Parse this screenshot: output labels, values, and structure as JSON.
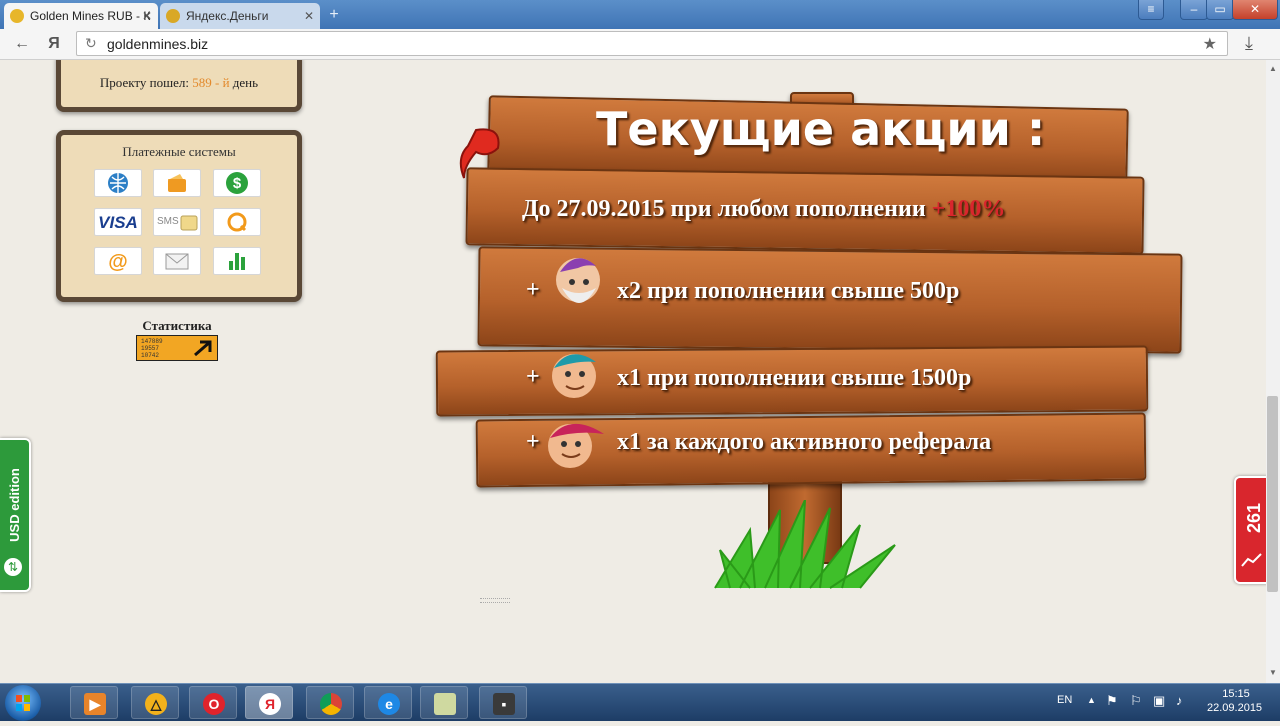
{
  "browser": {
    "tabs": [
      {
        "title": "Golden Mines RUB - К",
        "active": true
      },
      {
        "title": "Яндекс.Деньги",
        "active": false
      }
    ],
    "url": "goldenmines.biz",
    "yandex_glyph": "Я"
  },
  "sidebar": {
    "project_prefix": "Проекту пошел:",
    "project_day": "589 - й",
    "project_suffix": "день",
    "payment_title": "Платежные системы",
    "payment_icons": [
      "webmoney-icon",
      "wallet-icon",
      "dollar-icon",
      "visa-icon",
      "sms-icon",
      "qiwi-icon",
      "email-icon",
      "envelope-icon",
      "bars-icon"
    ],
    "visa_label": "VISA",
    "sms_label": "SMS",
    "stats_title": "Статистика",
    "stats_numbers": [
      "147889",
      "19557",
      "10742"
    ]
  },
  "sign": {
    "title": "Текущие акции :",
    "line1": "До 27.09.2015 при любом пополнении",
    "line1_bonus": "+100%",
    "offers": [
      {
        "plus": "+",
        "text": "x2 при пополнении свыше 500р"
      },
      {
        "plus": "+",
        "text": "x1 при пополнении свыше 1500р"
      },
      {
        "plus": "+",
        "text": "x1 за каждого активного реферала"
      }
    ]
  },
  "side_tabs": {
    "usd_edition": "USD edition",
    "counter": "261"
  },
  "taskbar": {
    "lang": "EN",
    "time": "15:15",
    "date": "22.09.2015"
  },
  "colors": {
    "bonus": "#d9262d",
    "day": "#e38a2c",
    "usd_green": "#2d9a3b"
  }
}
